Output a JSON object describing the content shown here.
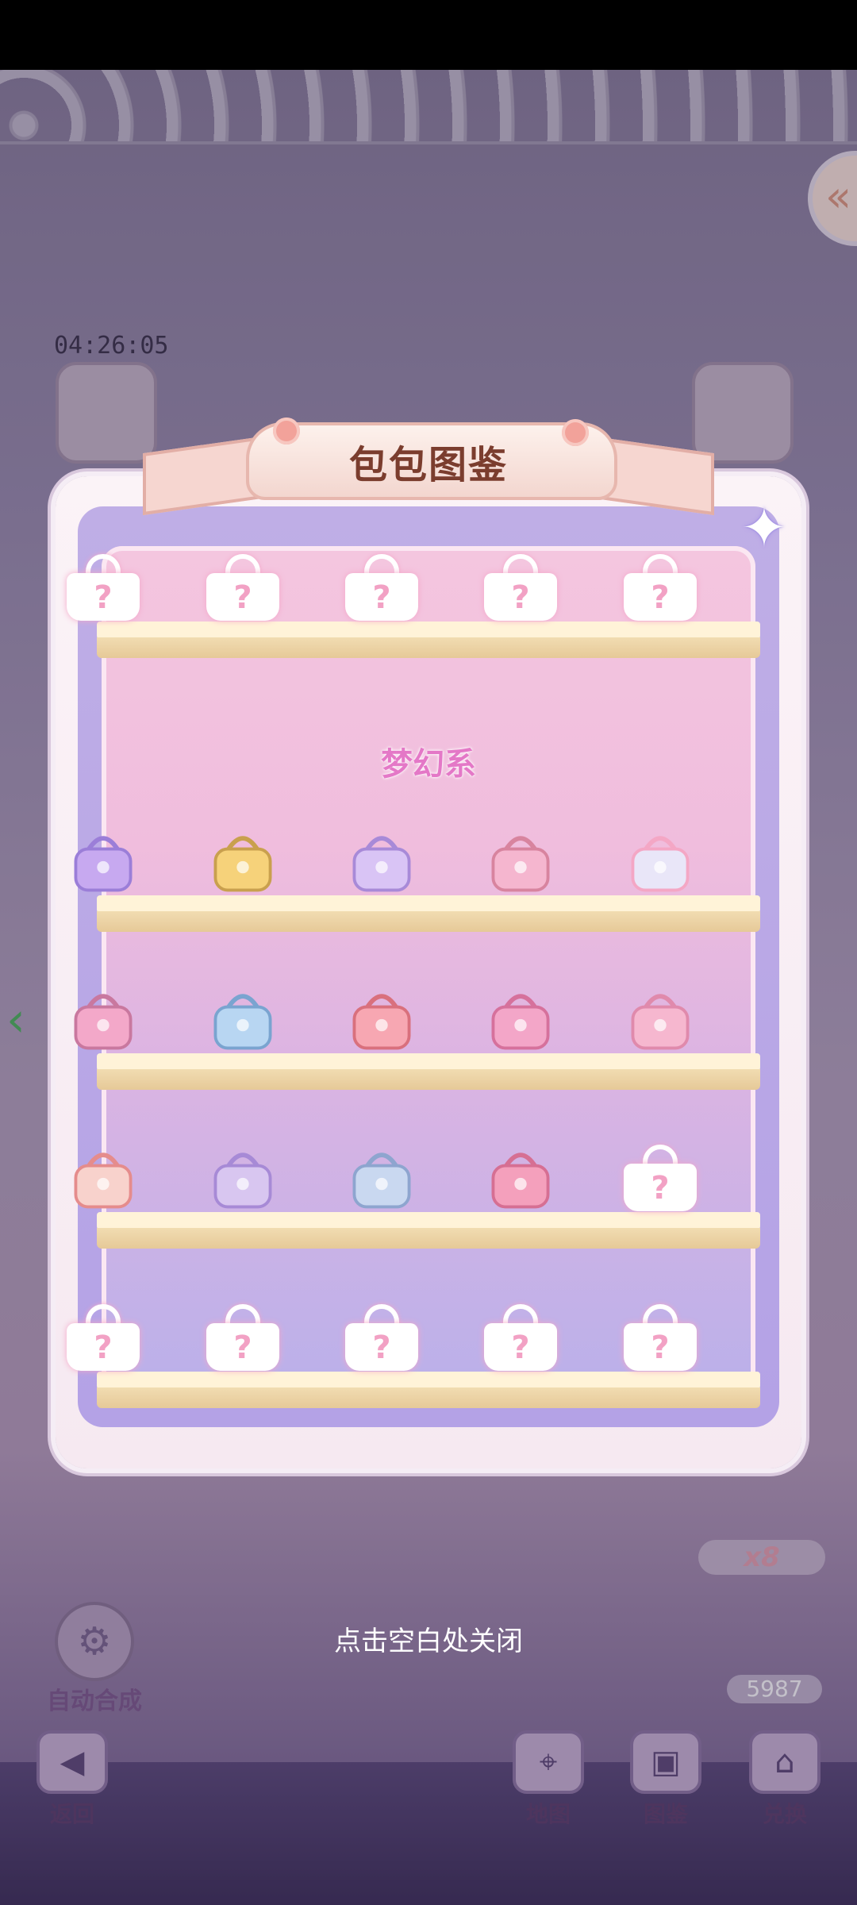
{
  "game": {
    "timer": "04:26:05",
    "collapse_icon": "«",
    "left_arrow": "‹",
    "multiplier": "x8",
    "coins": "5987",
    "auto_merge_label": "自动合成",
    "nav": [
      {
        "label": "返回",
        "icon": "back-arrow-icon",
        "glyph": "◀"
      },
      {
        "label": "地图",
        "icon": "map-icon",
        "glyph": "⌖"
      },
      {
        "label": "图鉴",
        "icon": "collection-icon",
        "glyph": "▣"
      },
      {
        "label": "兑换",
        "icon": "shop-icon",
        "glyph": "⌂"
      }
    ]
  },
  "modal": {
    "title": "包包图鉴",
    "close_glyph": "✦",
    "category": "梦幻系",
    "unknown_mark": "?",
    "shelves": [
      {
        "items": [
          "unknown",
          "unknown",
          "unknown",
          "unknown",
          "unknown"
        ]
      },
      {
        "items": [
          "flower-bag",
          "star-charm",
          "candy-bag",
          "rose-bag",
          "pearl-bag"
        ]
      },
      {
        "items": [
          "pink-box-bag",
          "nurse-backpack",
          "bow-bag",
          "tote-bag",
          "wing-bag"
        ]
      },
      {
        "items": [
          "heart-bag",
          "ribbon-bag",
          "quilted-bag",
          "glitter-bag",
          "unknown"
        ]
      },
      {
        "items": [
          "unknown",
          "unknown",
          "unknown",
          "unknown",
          "unknown"
        ]
      }
    ],
    "colors": {
      "accent_title": "#7b3d2e",
      "category": "#e478c7",
      "unknown_q": "#f2a1c4"
    }
  },
  "hint": "点击空白处关闭"
}
